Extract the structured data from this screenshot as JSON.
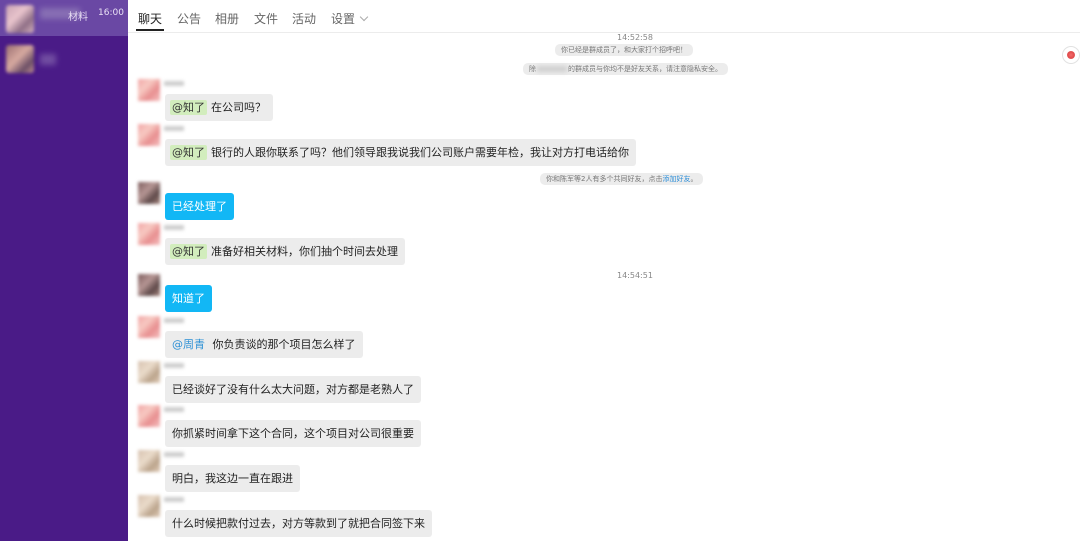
{
  "sidebar": {
    "active": {
      "name_fragment": "材料",
      "time": "16:00"
    }
  },
  "tabs": [
    {
      "label": "聊天"
    },
    {
      "label": "公告"
    },
    {
      "label": "相册"
    },
    {
      "label": "文件"
    },
    {
      "label": "活动"
    },
    {
      "label": "设置"
    }
  ],
  "chat": {
    "timestamp_1": "14:52:58",
    "system_1": "你已经是群成员了，和大家打个招呼吧！",
    "system_2_prefix": "除",
    "system_2_suffix": "的群成员与你均不是好友关系，请注意隐私安全。",
    "system_3_text": "你和陈军等2人有多个共同好友，点击",
    "system_3_link": "添加好友",
    "system_3_end": "。",
    "timestamp_2": "14:54:51",
    "messages": [
      {
        "mention": "@知了",
        "text": "在公司吗？"
      },
      {
        "mention": "@知了",
        "text": "银行的人跟你联系了吗？他们领导跟我说我们公司账户需要年检，我让对方打电话给你"
      },
      {
        "text": "已经处理了"
      },
      {
        "mention": "@知了",
        "text": "准备好相关材料，你们抽个时间去处理"
      },
      {
        "text": "知道了"
      },
      {
        "mention": "@周青",
        "text": "你负责谈的那个项目怎么样了"
      },
      {
        "text": "已经谈好了没有什么太大问题，对方都是老熟人了"
      },
      {
        "text": "你抓紧时间拿下这个合同，这个项目对公司很重要"
      },
      {
        "text": "明白，我这边一直在跟进"
      },
      {
        "text": "什么时候把款付过去，对方等款到了就把合同签下来"
      }
    ]
  },
  "colors": {
    "sidebar_bg": "#4a1b87",
    "sidebar_active": "#6a48a4",
    "own_bubble": "#12b7f5",
    "other_bubble": "#ececec",
    "mention_highlight": "#d2edbd",
    "link": "#2f8fd8"
  },
  "icons": [
    "group-avatar-icon",
    "chevron-down-icon",
    "floating-app-icon"
  ]
}
